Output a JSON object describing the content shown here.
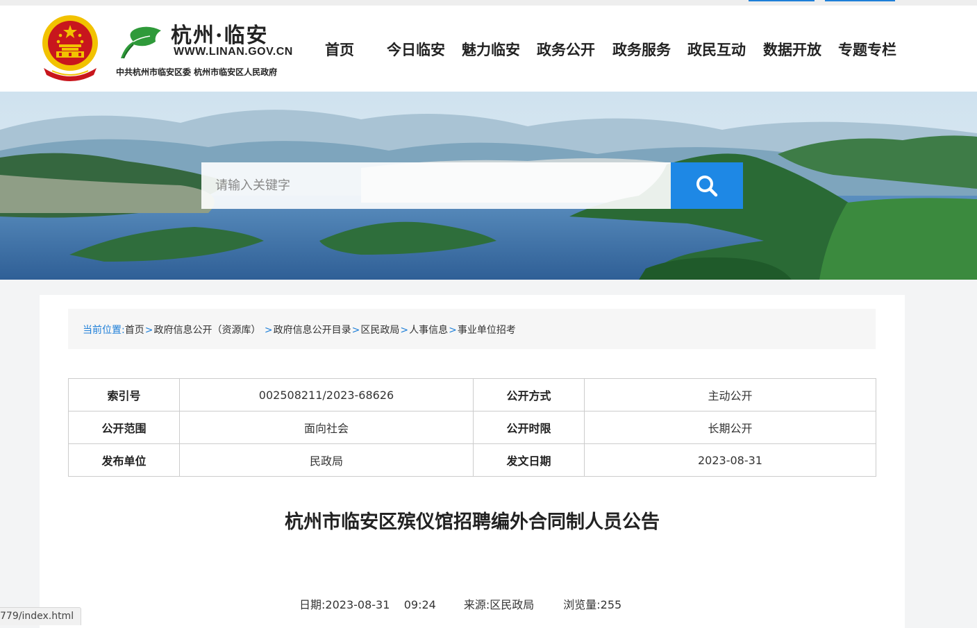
{
  "site": {
    "calligraphy": "杭州·临安",
    "domain": "WWW.LINAN.GOV.CN",
    "subtitle": "中共杭州市临安区委    杭州市临安区人民政府"
  },
  "nav": {
    "items": [
      "首页",
      "今日临安",
      "魅力临安",
      "政务公开",
      "政务服务",
      "政民互动",
      "数据开放",
      "专题专栏"
    ]
  },
  "search": {
    "placeholder": "请输入关键字"
  },
  "breadcrumb": {
    "label": "当前位置:",
    "items": [
      "首页",
      "政府信息公开（资源库）",
      "政府信息公开目录",
      "区民政局",
      "人事信息",
      "事业单位招考"
    ],
    "separator": ">"
  },
  "meta": {
    "rows": [
      [
        {
          "key": "索引号",
          "value": "002508211/2023-68626"
        },
        {
          "key": "公开方式",
          "value": "主动公开"
        }
      ],
      [
        {
          "key": "公开范围",
          "value": "面向社会"
        },
        {
          "key": "公开时限",
          "value": "长期公开"
        }
      ],
      [
        {
          "key": "发布单位",
          "value": "民政局"
        },
        {
          "key": "发文日期",
          "value": "2023-08-31"
        }
      ]
    ]
  },
  "article": {
    "title": "杭州市临安区殡仪馆招聘编外合同制人员公告",
    "date_label": "日期:",
    "date": "2023-08-31    09:24",
    "source_label": "来源:",
    "source": "区民政局",
    "views_label": "浏览量:",
    "views": "255"
  },
  "statusbar": {
    "url": "779/index.html"
  },
  "colors": {
    "accent": "#1e88e5",
    "link_blue": "#1e7fd8",
    "emblem_red": "#c8161d",
    "emblem_gold": "#f2c200"
  },
  "icons": {
    "search_button": "search-icon",
    "emblem": "national-emblem-icon",
    "logo": "ginkgo-leaf-icon"
  }
}
